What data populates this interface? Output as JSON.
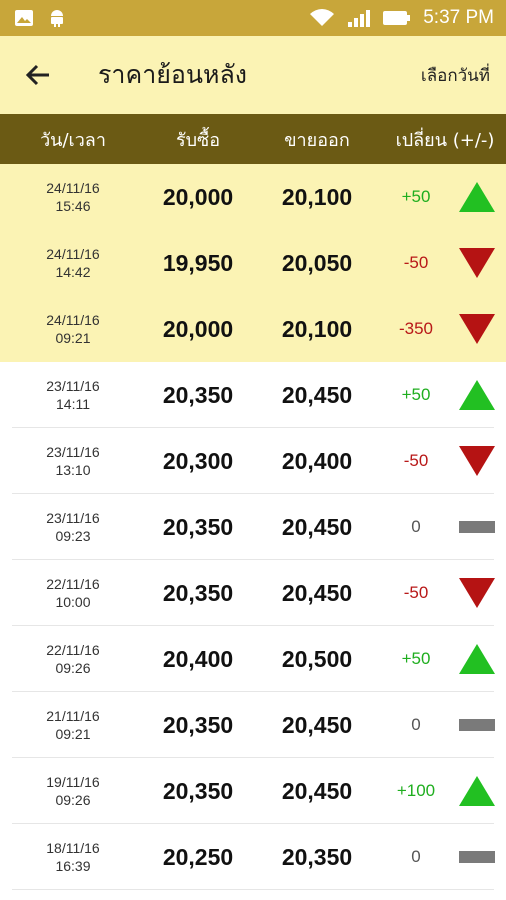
{
  "status_bar": {
    "time": "5:37 PM"
  },
  "header": {
    "title": "ราคาย้อนหลัง",
    "date_picker_label": "เลือกวันที่"
  },
  "columns": {
    "datetime": "วัน/เวลา",
    "buy": "รับซื้อ",
    "sell": "ขายออก",
    "change": "เปลี่ยน (+/-)"
  },
  "colors": {
    "status_bar": "#c8a63a",
    "app_bar": "#fbf3b4",
    "header_bar": "#6b5a14",
    "up": "#22c022",
    "down": "#b51313",
    "flat": "#7a7a7a"
  },
  "rows": [
    {
      "date": "24/11/16",
      "time": "15:46",
      "buy": "20,000",
      "sell": "20,100",
      "change": "+50",
      "trend": "up"
    },
    {
      "date": "24/11/16",
      "time": "14:42",
      "buy": "19,950",
      "sell": "20,050",
      "change": "-50",
      "trend": "down"
    },
    {
      "date": "24/11/16",
      "time": "09:21",
      "buy": "20,000",
      "sell": "20,100",
      "change": "-350",
      "trend": "down"
    },
    {
      "date": "23/11/16",
      "time": "14:11",
      "buy": "20,350",
      "sell": "20,450",
      "change": "+50",
      "trend": "up"
    },
    {
      "date": "23/11/16",
      "time": "13:10",
      "buy": "20,300",
      "sell": "20,400",
      "change": "-50",
      "trend": "down"
    },
    {
      "date": "23/11/16",
      "time": "09:23",
      "buy": "20,350",
      "sell": "20,450",
      "change": "0",
      "trend": "flat"
    },
    {
      "date": "22/11/16",
      "time": "10:00",
      "buy": "20,350",
      "sell": "20,450",
      "change": "-50",
      "trend": "down"
    },
    {
      "date": "22/11/16",
      "time": "09:26",
      "buy": "20,400",
      "sell": "20,500",
      "change": "+50",
      "trend": "up"
    },
    {
      "date": "21/11/16",
      "time": "09:21",
      "buy": "20,350",
      "sell": "20,450",
      "change": "0",
      "trend": "flat"
    },
    {
      "date": "19/11/16",
      "time": "09:26",
      "buy": "20,350",
      "sell": "20,450",
      "change": "+100",
      "trend": "up"
    },
    {
      "date": "18/11/16",
      "time": "16:39",
      "buy": "20,250",
      "sell": "20,350",
      "change": "0",
      "trend": "flat"
    }
  ]
}
